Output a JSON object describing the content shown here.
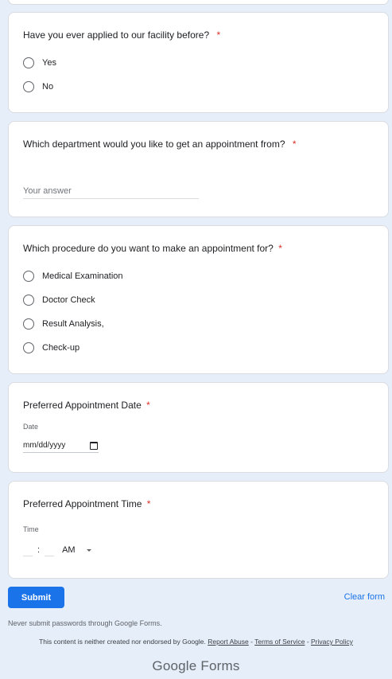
{
  "q1": {
    "title": "Have you ever applied to our facility before?",
    "required": "*",
    "options": [
      "Yes",
      "No"
    ]
  },
  "q2": {
    "title": "Which department would you like to get an appointment from?",
    "required": "*",
    "placeholder": "Your answer"
  },
  "q3": {
    "title": "Which procedure do you want to make an appointment for?",
    "required": "*",
    "options": [
      "Medical Examination",
      "Doctor Check",
      "Result Analysis,",
      "Check-up"
    ]
  },
  "q4": {
    "title": "Preferred Appointment Date",
    "required": "*",
    "sublabel": "Date",
    "value": "mm/dd/yyyy",
    "icon": "calendar-icon"
  },
  "q5": {
    "title": "Preferred Appointment Time",
    "required": "*",
    "sublabel": "Time",
    "colon": ":",
    "ampm": "AM",
    "icon": "dropdown-arrow-icon"
  },
  "footer": {
    "submit": "Submit",
    "clear": "Clear form",
    "note": "Never submit passwords through Google Forms.",
    "disclaimer": "This content is neither created nor endorsed by Google.",
    "report_abuse": "Report Abuse",
    "sep": " - ",
    "terms": "Terms of Service",
    "privacy": "Privacy Policy",
    "brand_google": "Google",
    "brand_forms": "Forms"
  },
  "colors": {
    "background": "#e6eef9",
    "accent": "#1a73e8",
    "required": "#d93025"
  }
}
